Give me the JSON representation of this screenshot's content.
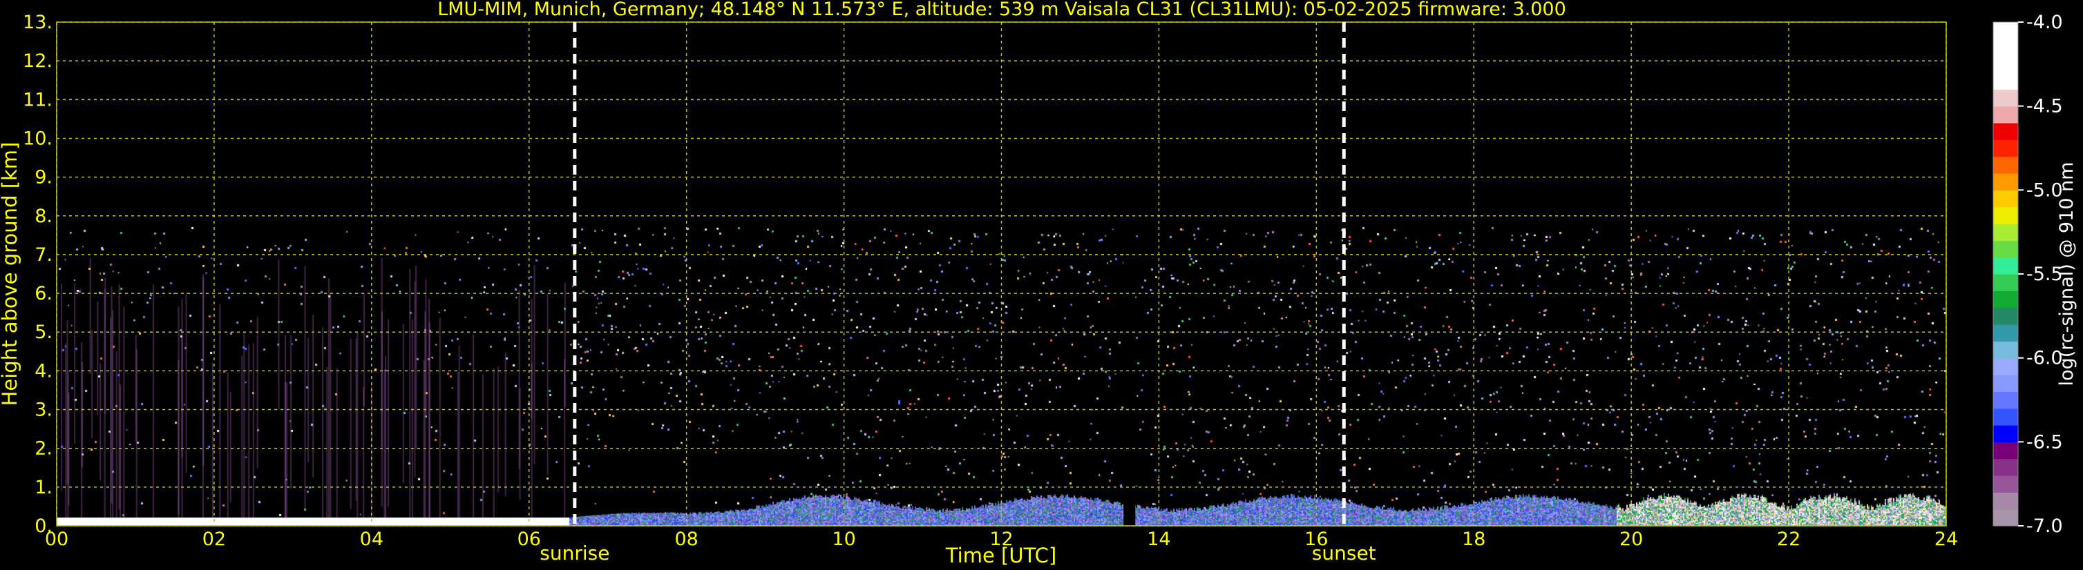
{
  "chart_data": {
    "type": "heatmap",
    "title": "LMU-MIM, Munich, Germany; 48.148° N 11.573° E, altitude: 539 m    Vaisala CL31 (CL31LMU): 05-02-2025    firmware: 3.000",
    "xlabel": "Time [UTC]",
    "ylabel": "Height above ground [km]",
    "xlim": [
      0,
      24
    ],
    "ylim": [
      0,
      13
    ],
    "xticks": [
      0,
      2,
      4,
      6,
      8,
      10,
      12,
      14,
      16,
      18,
      20,
      22,
      24
    ],
    "xtick_labels": [
      "00",
      "02",
      "04",
      "06",
      "08",
      "10",
      "12",
      "14",
      "16",
      "18",
      "20",
      "22",
      "24"
    ],
    "yticks": [
      0,
      1,
      2,
      3,
      4,
      5,
      6,
      7,
      8,
      9,
      10,
      11,
      12,
      13
    ],
    "ytick_labels": [
      "0.",
      "1.",
      "2.",
      "3.",
      "4.",
      "5.",
      "6.",
      "7.",
      "8.",
      "9.",
      "10.",
      "11.",
      "12.",
      "13."
    ],
    "grid": true,
    "signal_top_km": 7.7,
    "data_gap_hours": [
      13.55,
      13.7
    ],
    "annotations": [
      {
        "label": "sunrise",
        "time_utc": 6.58
      },
      {
        "label": "sunset",
        "time_utc": 16.35
      }
    ],
    "colorbar": {
      "label": "log(rc-signal) @ 910 nm",
      "range": [
        -7.0,
        -4.0
      ],
      "ticks": [
        -4.0,
        -4.5,
        -5.0,
        -5.5,
        -6.0,
        -6.5,
        -7.0
      ],
      "tick_labels": [
        "-4.0",
        "-4.5",
        "-5.0",
        "-5.5",
        "-6.0",
        "-6.5",
        "-7.0"
      ],
      "colors": [
        "#a995a9",
        "#a888a8",
        "#995599",
        "#883388",
        "#770077",
        "#0000ff",
        "#3355ff",
        "#6677ff",
        "#8899ff",
        "#99aaff",
        "#77bbdd",
        "#3399aa",
        "#228866",
        "#11aa33",
        "#33cc55",
        "#33ee99",
        "#66dd44",
        "#aaee33",
        "#eeee00",
        "#ffcc00",
        "#ff9900",
        "#ff6600",
        "#ff2200",
        "#ee0000",
        "#eeaaaa",
        "#eecccc",
        "#ffffff",
        "#ffffff",
        "#ffffff",
        "#ffffff"
      ]
    }
  }
}
